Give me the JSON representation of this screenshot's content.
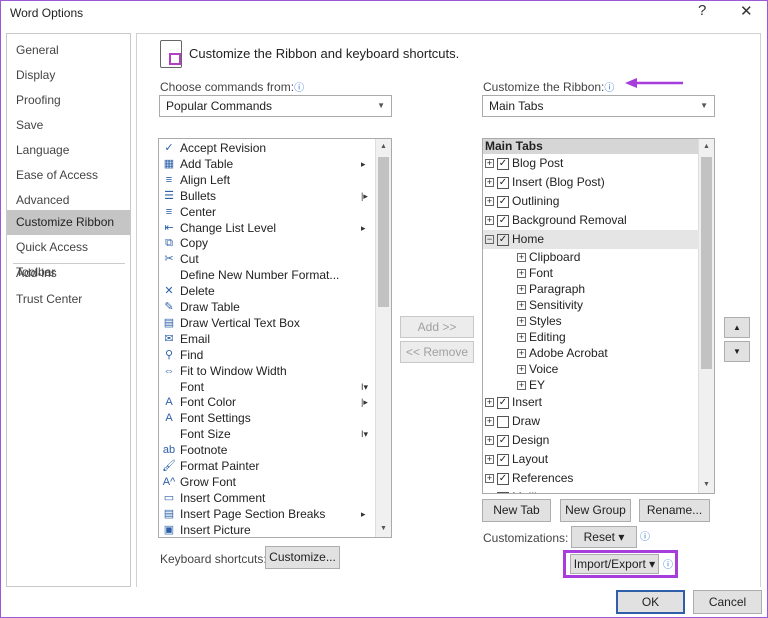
{
  "window": {
    "title": "Word Options",
    "help": "?",
    "close": "✕"
  },
  "sidebar": {
    "items": [
      "General",
      "Display",
      "Proofing",
      "Save",
      "Language",
      "Ease of Access",
      "Advanced",
      "Customize Ribbon",
      "Quick Access Toolbar",
      "Add-ins",
      "Trust Center"
    ],
    "selected": "Customize Ribbon"
  },
  "header": {
    "text": "Customize the Ribbon and keyboard shortcuts."
  },
  "left": {
    "label": "Choose commands from:",
    "select": "Popular Commands",
    "commands": [
      {
        "t": "Accept Revision",
        "i": "✓"
      },
      {
        "t": "Add Table",
        "i": "▦",
        "tag": "▸"
      },
      {
        "t": "Align Left",
        "i": "≡"
      },
      {
        "t": "Bullets",
        "i": "☰",
        "tag": "|▸"
      },
      {
        "t": "Center",
        "i": "≡"
      },
      {
        "t": "Change List Level",
        "i": "⇤",
        "tag": "▸"
      },
      {
        "t": "Copy",
        "i": "⧉"
      },
      {
        "t": "Cut",
        "i": "✂"
      },
      {
        "t": "Define New Number Format...",
        "i": ""
      },
      {
        "t": "Delete",
        "i": "✕"
      },
      {
        "t": "Draw Table",
        "i": "✎"
      },
      {
        "t": "Draw Vertical Text Box",
        "i": "▤"
      },
      {
        "t": "Email",
        "i": "✉"
      },
      {
        "t": "Find",
        "i": "⚲"
      },
      {
        "t": "Fit to Window Width",
        "i": "⇔"
      },
      {
        "t": "Font",
        "i": "",
        "tag": "I▾"
      },
      {
        "t": "Font Color",
        "i": "A",
        "tag": "|▸"
      },
      {
        "t": "Font Settings",
        "i": "A"
      },
      {
        "t": "Font Size",
        "i": "",
        "tag": "I▾"
      },
      {
        "t": "Footnote",
        "i": "ab"
      },
      {
        "t": "Format Painter",
        "i": "🖌"
      },
      {
        "t": "Grow Font",
        "i": "A^"
      },
      {
        "t": "Insert Comment",
        "i": "▭"
      },
      {
        "t": "Insert Page  Section Breaks",
        "i": "▤",
        "tag": "▸"
      },
      {
        "t": "Insert Picture",
        "i": "▣"
      }
    ]
  },
  "middle": {
    "add": "Add >>",
    "remove": "<< Remove"
  },
  "right": {
    "label": "Customize the Ribbon:",
    "select": "Main Tabs",
    "tree_header": "Main Tabs",
    "tree": [
      {
        "t": "Blog Post",
        "lvl": 0,
        "cb": true
      },
      {
        "t": "Insert (Blog Post)",
        "lvl": 0,
        "cb": true
      },
      {
        "t": "Outlining",
        "lvl": 0,
        "cb": true
      },
      {
        "t": "Background Removal",
        "lvl": 0,
        "cb": true
      },
      {
        "t": "Home",
        "lvl": 0,
        "cb": true,
        "open": true,
        "sel": true
      },
      {
        "t": "Clipboard",
        "lvl": 1
      },
      {
        "t": "Font",
        "lvl": 1
      },
      {
        "t": "Paragraph",
        "lvl": 1
      },
      {
        "t": "Sensitivity",
        "lvl": 1
      },
      {
        "t": "Styles",
        "lvl": 1
      },
      {
        "t": "Editing",
        "lvl": 1
      },
      {
        "t": "Adobe Acrobat",
        "lvl": 1
      },
      {
        "t": "Voice",
        "lvl": 1
      },
      {
        "t": "EY",
        "lvl": 1
      },
      {
        "t": "Insert",
        "lvl": 0,
        "cb": true
      },
      {
        "t": "Draw",
        "lvl": 0,
        "cb": false
      },
      {
        "t": "Design",
        "lvl": 0,
        "cb": true
      },
      {
        "t": "Layout",
        "lvl": 0,
        "cb": true
      },
      {
        "t": "References",
        "lvl": 0,
        "cb": true
      },
      {
        "t": "Mailings",
        "lvl": 0,
        "cb": true
      }
    ],
    "new_tab": "New Tab",
    "new_group": "New Group",
    "rename": "Rename...",
    "customizations": "Customizations:",
    "reset": "Reset ▾",
    "import_export": "Import/Export ▾"
  },
  "keyboard": {
    "label": "Keyboard shortcuts:",
    "button": "Customize..."
  },
  "footer": {
    "ok": "OK",
    "cancel": "Cancel"
  },
  "colors": {
    "highlight": "#a63ddc",
    "selected": "#c5c5c5",
    "ok_border": "#2f5fa8"
  }
}
